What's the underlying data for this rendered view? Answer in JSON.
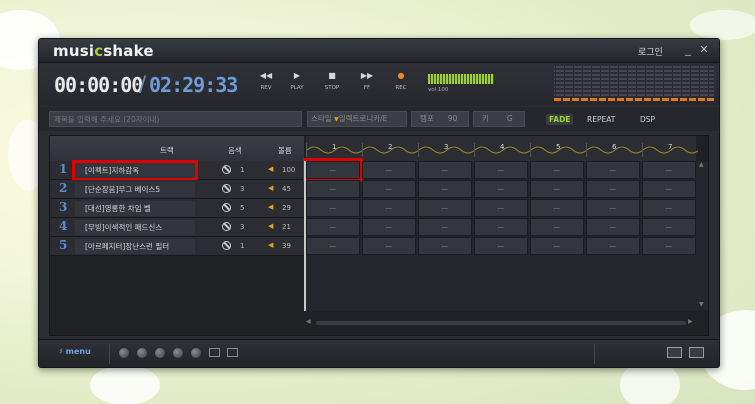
{
  "app": {
    "logo_main": "musi",
    "logo_accent": "c",
    "logo_rest": "shake",
    "login": "로그인",
    "minimize": "_",
    "close": "✕"
  },
  "transport": {
    "time_now": "00:00:00",
    "separator": "/",
    "time_total": "02:29:33",
    "buttons": [
      {
        "icon": "◀◀",
        "label": "REV"
      },
      {
        "icon": "▶",
        "label": "PLAY"
      },
      {
        "icon": "■",
        "label": "STOP"
      },
      {
        "icon": "▶▶",
        "label": "FF"
      },
      {
        "icon": "●",
        "label": "REC"
      }
    ],
    "volume_label": "vol.100"
  },
  "info": {
    "title_placeholder": "제목을 입력해 주세요.(20자이내)",
    "style_label": "스타일",
    "style_value": "일렉트로니카/E",
    "tempo_label": "템포",
    "tempo_value": "90",
    "key_label": "키",
    "key_value": "G",
    "fade": "FADE",
    "repeat": "REPEAT",
    "dsp": "DSP"
  },
  "tracks": {
    "headers": {
      "track": "트랙",
      "mute": "음색",
      "volume": "볼륨"
    },
    "rows": [
      {
        "num": "1",
        "name": "[이펙트]지하감옥",
        "mute": "1",
        "vol": "100"
      },
      {
        "num": "2",
        "name": "[단순장음]무그 베이스5",
        "mute": "3",
        "vol": "45"
      },
      {
        "num": "3",
        "name": "[대선]영롱한 차임 벨",
        "mute": "5",
        "vol": "29"
      },
      {
        "num": "4",
        "name": "[무빙]이색적인 패드신스",
        "mute": "3",
        "vol": "21"
      },
      {
        "num": "5",
        "name": "[아르페지터]장난스런 필터",
        "mute": "1",
        "vol": "39"
      }
    ]
  },
  "bars": [
    "1",
    "2",
    "3",
    "4",
    "5",
    "6",
    "7"
  ],
  "slot_text": "—",
  "bottom": {
    "menu": "menu"
  },
  "colors": {
    "accent_green": "#9fd13a",
    "accent_blue": "#6d9cd6",
    "rec_orange": "#f08a1c",
    "highlight_red": "#e00000"
  }
}
